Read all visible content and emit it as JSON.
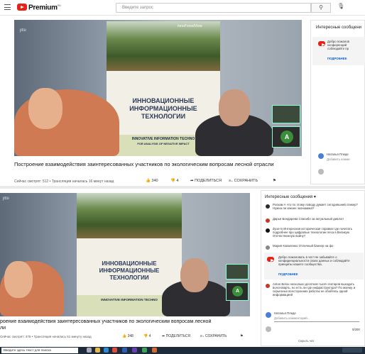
{
  "header": {
    "brand": "Premium",
    "brand_sup": "RU",
    "search_placeholder": "Введите запрос"
  },
  "video": {
    "watermark": "jitsi",
    "poster_brand": "InnoForestView",
    "poster_title_1": "ИННОВАЦИОННЫЕ",
    "poster_title_2": "ИНФОРМАЦИОННЫЕ",
    "poster_title_3": "ТЕХНОЛОГИИ",
    "poster_en_1": "INNOVATIVE INFORMATION TECHNO",
    "poster_en_2": "FOR ANALYSIS OF NEGATIVE IMPACT",
    "participant_initial": "A"
  },
  "top": {
    "title": "Построение взаимодействия заинтересованных участников по экологическим вопросам лесной отрасли",
    "meta": "Сейчас смотрят: 512 • Трансляция началась 16 минут назад",
    "likes": "340",
    "dislikes": "4",
    "share": "ПОДЕЛИТЬСЯ",
    "save": "СОХРАНИТЬ",
    "chat_header": "Интересные сообщени",
    "pinned": "Добро пожалов конференций соблюдайте пр",
    "more": "ПОДРОБНЕЕ",
    "user": "Наталья Пледе",
    "add_comment": "Добавить комме"
  },
  "bottom": {
    "title_1": "роение взаимодействия заинтересованных участников по экологическим вопросам лесной",
    "title_2": "ли",
    "meta": "Сейчас смотрят: 475 • Трансляция началась 51 минуту назад",
    "likes": "348",
    "dislikes": "4",
    "share": "ПОДЕЛИТЬСЯ",
    "save": "СОХРАНИТЬ",
    "chat_header": "Интересные сообщения ▾",
    "messages": [
      {
        "text": "Роскам  А что по этому поводу думает сегодняшний спикер? Нужна ли законе экономика?"
      },
      {
        "text": "Дарья Бондарева  Спасибо за актуальный диалог!"
      },
      {
        "text": "dyus-m  Интересная историческая справка! где почитать подробнее про цифровые технологии леса в Великую Отечественную войну?"
      },
      {
        "text": "Мария Коваленко  Отличный баннер на фо"
      }
    ],
    "pinned": "Добро пожаловать в чат! Не забывайте о конфиденциальности своих данных и соблюдайте принципы нашего сообщества.",
    "more": "ПОДРОБНЕЕ",
    "long_msg": "Anton Belov  несколько десятков тысяч гектаров выходить вологоварть, но есть ли где инфраструктура? По моему, и серьезных всесторонних работах не обойтись одной информацией",
    "user": "Наталья Пледе",
    "add_comment": "Добавить комментарий...",
    "counter": "0/200",
    "hide_chat": "Скрыть чат"
  },
  "taskbar": {
    "search": "Введите здесь текст для поиска"
  },
  "colors": {
    "youtube_red": "#e62117",
    "link_blue": "#065fd4"
  }
}
